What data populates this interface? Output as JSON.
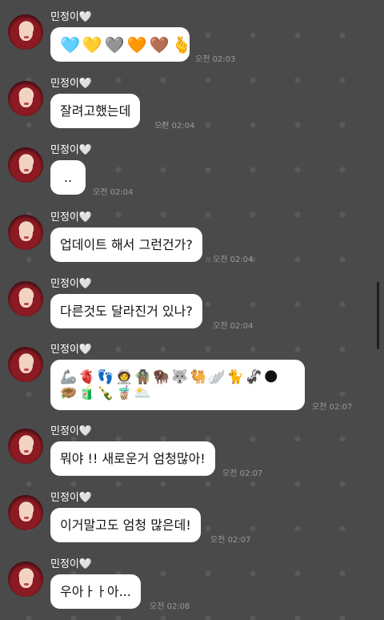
{
  "sender": {
    "name": "민정이",
    "heart": "🤍"
  },
  "messages": [
    {
      "type": "emoji",
      "emojis": [
        "🩵",
        "💛",
        "🩶",
        "🧡",
        "🤎",
        "🫰"
      ],
      "time": "오전 02:03"
    },
    {
      "type": "text",
      "text": "잘려고했는데",
      "time": "오전 02:04"
    },
    {
      "type": "text",
      "text": "..",
      "time": "오전 02:04"
    },
    {
      "type": "text",
      "text": "업데이트 해서 그런건가?",
      "time": "오전 02:04"
    },
    {
      "type": "text",
      "text": "다른것도 달라진거 있나?",
      "time": "오전 02:04"
    },
    {
      "type": "emoji2",
      "row1": [
        "🦾",
        "🫀",
        "👣",
        "🧑‍🚀",
        "🧌",
        "🦬",
        "🐺",
        "🐫",
        "🪽",
        "🐈",
        "🦨",
        "🌑"
      ],
      "row2": [
        "🪹",
        "🧃",
        "🍾",
        "🧋",
        "🌥️"
      ],
      "time": "오전 02:07"
    },
    {
      "type": "text",
      "text": "뭐야 !! 새로운거 엄청많아!",
      "time": "오전 02:07"
    },
    {
      "type": "text",
      "text": "이거말고도 엄청 많은데!",
      "time": "오전 02:07"
    },
    {
      "type": "text",
      "text": "우아ㅏㅏ아...",
      "time": "오전 02:08"
    }
  ]
}
